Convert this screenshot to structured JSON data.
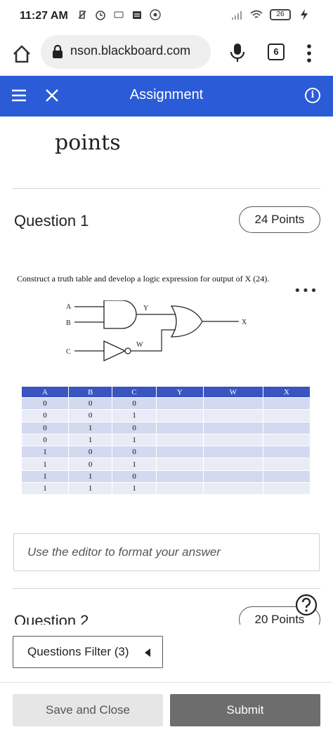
{
  "status_bar": {
    "time": "11:27 AM",
    "battery": "26",
    "icons": [
      "vibrate-off-icon",
      "alarm-icon",
      "message-icon",
      "notes-icon",
      "vpn-icon",
      "signal-icon",
      "wifi-icon",
      "battery-icon",
      "charging-icon"
    ]
  },
  "browser": {
    "url": "nson.blackboard.com",
    "tab_count": "6"
  },
  "header": {
    "title": "Assignment",
    "info_label": "i",
    "accent_color": "#2b5bd6"
  },
  "previous_question": {
    "points_label": "points"
  },
  "question1": {
    "title": "Question 1",
    "points": "24 Points",
    "prompt": "Construct a truth table and develop a logic expression for output of X (24).",
    "more_label": "•••",
    "circuit": {
      "input_a": "A",
      "input_b": "B",
      "input_c": "C",
      "label_y": "Y",
      "label_w": "W",
      "output_x": "X"
    },
    "table": {
      "headers": [
        "A",
        "B",
        "C",
        "Y",
        "W",
        "X"
      ],
      "rows": [
        [
          "0",
          "0",
          "0",
          "",
          "",
          ""
        ],
        [
          "0",
          "0",
          "1",
          "",
          "",
          ""
        ],
        [
          "0",
          "1",
          "0",
          "",
          "",
          ""
        ],
        [
          "0",
          "1",
          "1",
          "",
          "",
          ""
        ],
        [
          "1",
          "0",
          "0",
          "",
          "",
          ""
        ],
        [
          "1",
          "0",
          "1",
          "",
          "",
          ""
        ],
        [
          "1",
          "1",
          "0",
          "",
          "",
          ""
        ],
        [
          "1",
          "1",
          "1",
          "",
          "",
          ""
        ]
      ]
    },
    "answer_placeholder": "Use the editor to format your answer"
  },
  "question2": {
    "title": "Question 2",
    "points": "20 Points"
  },
  "footer": {
    "filter_label": "Questions Filter (3)",
    "save_label": "Save and Close",
    "submit_label": "Submit"
  }
}
